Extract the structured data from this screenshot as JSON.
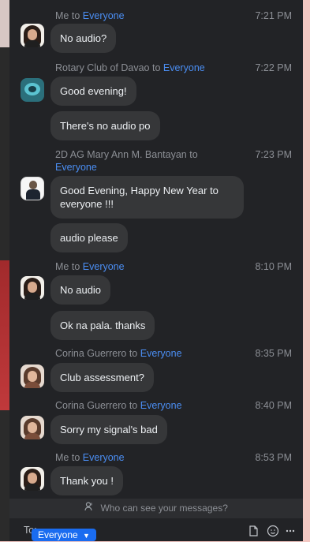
{
  "messages": [
    {
      "sender": "Me",
      "to_word": "to",
      "recipient": "Everyone",
      "time": "7:21 PM",
      "avatar": "user-avatar-icon",
      "bubbles": [
        "No audio?"
      ]
    },
    {
      "sender": "Rotary Club of Davao",
      "to_word": "to",
      "recipient": "Everyone",
      "time": "7:22 PM",
      "avatar": "rotary-club-avatar-icon",
      "bubbles": [
        "Good evening!",
        "There's no audio po"
      ]
    },
    {
      "sender": "2D AG Mary Ann M. Bantayan",
      "to_word": "to",
      "recipient": "Everyone",
      "time": "7:23 PM",
      "avatar": "mary-ann-avatar-icon",
      "bubbles": [
        "Good Evening, Happy New Year to everyone !!!",
        "audio please"
      ]
    },
    {
      "sender": "Me",
      "to_word": "to",
      "recipient": "Everyone",
      "time": "8:10 PM",
      "avatar": "user-avatar-icon",
      "bubbles": [
        "No audio",
        "Ok na pala. thanks"
      ]
    },
    {
      "sender": "Corina Guerrero",
      "to_word": "to",
      "recipient": "Everyone",
      "time": "8:35 PM",
      "avatar": "corina-avatar-icon",
      "bubbles": [
        "Club assessment?"
      ]
    },
    {
      "sender": "Corina Guerrero",
      "to_word": "to",
      "recipient": "Everyone",
      "time": "8:40 PM",
      "avatar": "corina-avatar-icon",
      "bubbles": [
        "Sorry my signal's bad"
      ]
    },
    {
      "sender": "Me",
      "to_word": "to",
      "recipient": "Everyone",
      "time": "8:53 PM",
      "avatar": "user-avatar-icon",
      "bubbles": [
        "Thank you !"
      ]
    }
  ],
  "footer": {
    "privacy_text": "Who can see your messages?",
    "to_label": "To:",
    "recipient_select": "Everyone",
    "icons": [
      "file-icon",
      "emoji-icon",
      "more-icon"
    ]
  },
  "colors": {
    "panel_bg": "#222326",
    "bubble_bg": "#363739",
    "recipient_link": "#4b8ef3",
    "accent_button": "#1a6cf0"
  }
}
